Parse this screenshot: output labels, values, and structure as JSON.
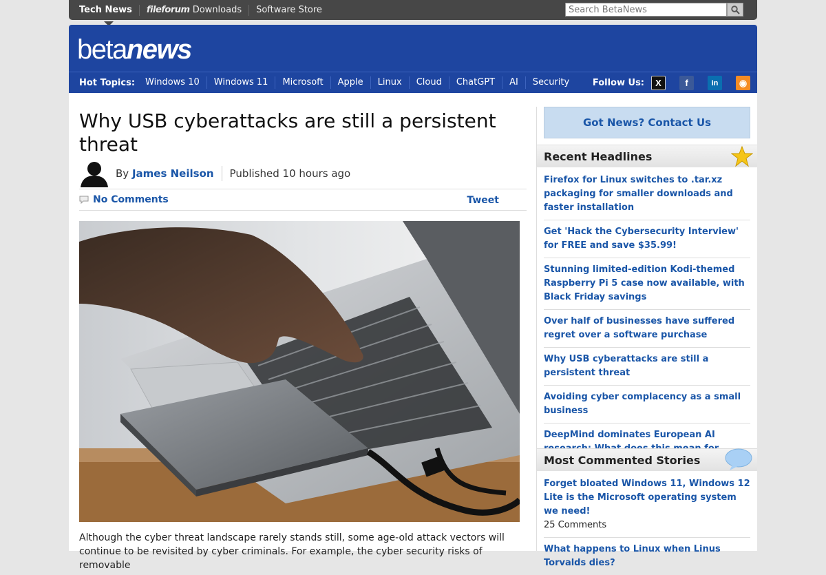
{
  "topnav": {
    "items": [
      {
        "label": "Tech News"
      },
      {
        "brand": "fileforum",
        "label": "Downloads"
      },
      {
        "label": "Software Store"
      }
    ],
    "search_placeholder": "Search BetaNews"
  },
  "header": {
    "logo_part1": "beta",
    "logo_part2": "news",
    "hot_topics_label": "Hot Topics:",
    "hot_topics": [
      "Windows 10",
      "Windows 11",
      "Microsoft",
      "Apple",
      "Linux",
      "Cloud",
      "ChatGPT",
      "AI",
      "Security"
    ],
    "follow_label": "Follow Us:",
    "social": [
      {
        "icon": "x-icon",
        "glyph": "X"
      },
      {
        "icon": "facebook-icon",
        "glyph": "f"
      },
      {
        "icon": "linkedin-icon",
        "glyph": "in"
      },
      {
        "icon": "rss-icon",
        "glyph": "◉"
      }
    ]
  },
  "article": {
    "title": "Why USB cyberattacks are still a persistent threat",
    "by_label": "By",
    "author": "James Neilson",
    "published": "Published 10 hours ago",
    "comments": "No Comments",
    "tweet": "Tweet",
    "body": "Although the cyber threat landscape rarely stands still, some age-old attack vectors will continue to be revisited by cyber criminals. For example, the cyber security risks of removable"
  },
  "sidebar": {
    "got_news": "Got News? Contact Us",
    "recent_title": "Recent Headlines",
    "recent": [
      "Firefox for Linux switches to .tar.xz packaging for smaller downloads and faster installation",
      "Get 'Hack the Cybersecurity Interview' for FREE and save $35.99!",
      "Stunning limited-edition Kodi-themed Raspberry Pi 5 case now available, with Black Friday savings",
      "Over half of businesses have suffered regret over a software purchase",
      "Why USB cyberattacks are still a persistent threat",
      "Avoiding cyber complacency as a small business",
      "DeepMind dominates European AI research: What does this mean for researchers?"
    ],
    "most_commented_title": "Most Commented Stories",
    "most_commented": [
      {
        "title": "Forget bloated Windows 11, Windows 12 Lite is the Microsoft operating system we need!",
        "count": "25 Comments"
      },
      {
        "title": "What happens to Linux when Linus Torvalds dies?",
        "count": ""
      }
    ]
  },
  "colors": {
    "header_blue": "#1e45a0",
    "link_blue": "#1a56a8",
    "topbar_gray": "#474747"
  }
}
